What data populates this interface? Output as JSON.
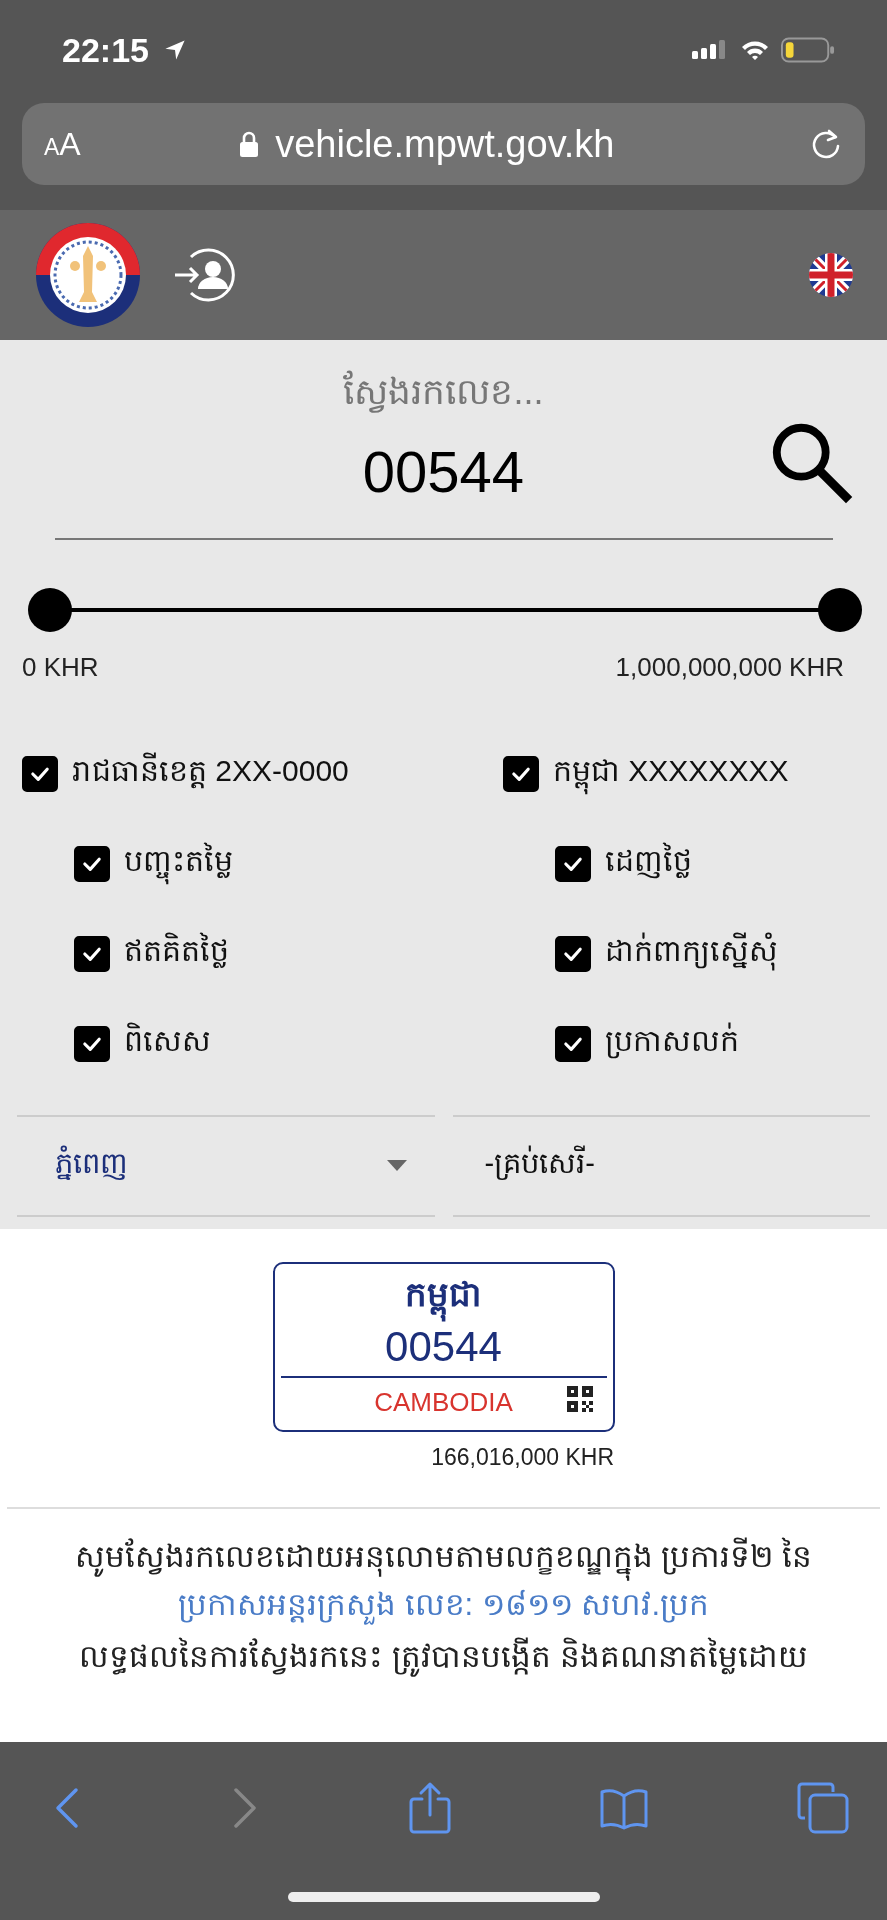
{
  "status_bar": {
    "time": "22:15"
  },
  "address_bar": {
    "text_size_button": "AA",
    "url": "vehicle.mpwt.gov.kh"
  },
  "search": {
    "placeholder": "ស្វែងរកលេខ...",
    "value": "00544"
  },
  "price_slider": {
    "thumbs": [
      {
        "level": 0
      },
      {
        "level": 1
      }
    ],
    "min_label": "0 KHR",
    "max_label": "1,000,000,000 KHR"
  },
  "filter_groups": [
    {
      "label": "រាជធានីខេត្ត 2XX-0000",
      "checked": true,
      "children": [
        {
          "label": "បញ្ចុះតម្លៃ",
          "checked": true
        },
        {
          "label": "ឥតគិតថ្លៃ",
          "checked": true
        },
        {
          "label": "ពិសេស",
          "checked": true
        }
      ]
    },
    {
      "label": "កម្ពុជា XXXXXXXX",
      "checked": true,
      "children": [
        {
          "label": "ដេញថ្លៃ",
          "checked": true
        },
        {
          "label": "ដាក់ពាក្យស្នើសុំ",
          "checked": true
        },
        {
          "label": "ប្រកាសលក់",
          "checked": true
        }
      ]
    }
  ],
  "dropdowns": [
    {
      "kind": "select",
      "value": "ភ្នំពេញ"
    },
    {
      "kind": "text",
      "value": "-គ្រប់សេរី-"
    }
  ],
  "plate": {
    "title": "កម្ពុជា",
    "number": "00544",
    "country": "CAMBODIA",
    "price": "166,016,000 KHR"
  },
  "notice": {
    "text": "សូមស្វែងរកលេខដោយអនុលោមតាមលក្ខខណ្ឌក្នុង ប្រការទី២ នៃ",
    "link": "ប្រកាសអន្តរក្រសួង លេខ: ១៨១១ សហវ.ប្រក",
    "note": "លទ្ធផលនៃការស្វែងរកនេះ ត្រូវបានបង្កើត និងគណនាតម្លៃដោយ"
  },
  "toolbar": [
    {
      "kind": "back",
      "disabled": false
    },
    {
      "kind": "forward",
      "disabled": true
    },
    {
      "kind": "share",
      "disabled": false
    },
    {
      "kind": "bookmarks",
      "disabled": false
    },
    {
      "kind": "tabs",
      "disabled": false
    }
  ]
}
